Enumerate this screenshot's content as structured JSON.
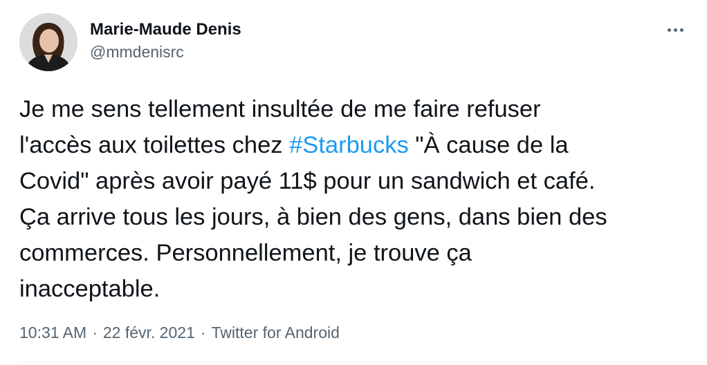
{
  "author": {
    "display_name": "Marie-Maude Denis",
    "handle": "@mmdenisrc"
  },
  "more_icon": "more-horizontal-icon",
  "tweet": {
    "text_before_hashtag": "Je me sens tellement insultée de me faire refuser\nl'accès aux toilettes chez ",
    "hashtag": "#Starbucks",
    "text_after_hashtag": " \"À cause de la\nCovid\" après avoir payé 11$ pour un sandwich et café.\nÇa arrive tous les jours, à bien des gens, dans bien des\ncommerces. Personnellement, je trouve ça\ninacceptable."
  },
  "meta": {
    "time": "10:31 AM",
    "separator": "·",
    "date": "22 févr. 2021",
    "source": "Twitter for Android"
  },
  "colors": {
    "text": "#0f1419",
    "secondary": "#536471",
    "link": "#1d9bf0",
    "divider": "#eff3f4"
  }
}
